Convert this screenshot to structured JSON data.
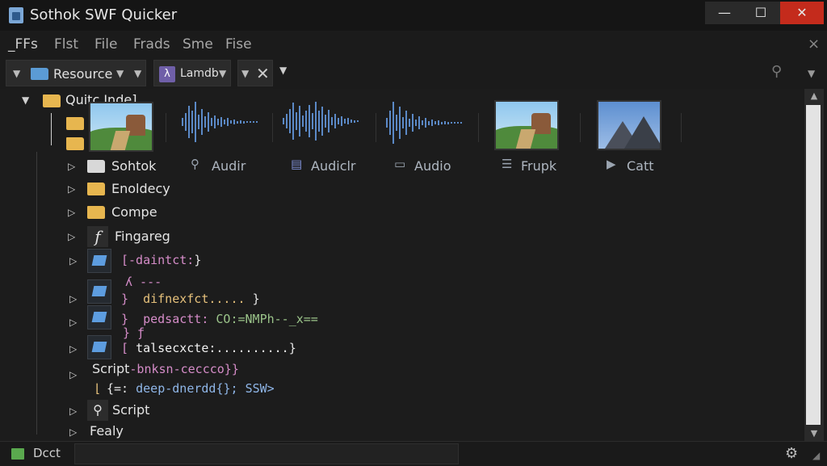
{
  "window": {
    "title": "Sothok SWF Quicker",
    "controls": {
      "minimize": "—",
      "maximize": "☐",
      "close": "✕"
    }
  },
  "menubar": {
    "items": [
      "_FFs",
      "Flst",
      "File",
      "Frads",
      "Sme",
      "Fise"
    ],
    "close_glyph": "×"
  },
  "toolbar": {
    "resource_label": "Resource",
    "lambda_label": "Lamdb",
    "lambda_glyph": "λ",
    "dropdown_glyph": "▼",
    "clear_glyph": "✕",
    "right_icon_glyph": "⚲"
  },
  "tree": {
    "root_label": "Quitc Inde]",
    "media_items": [
      {
        "type": "image",
        "label": ""
      },
      {
        "type": "audio",
        "label": "Audir",
        "glyph": "⚲"
      },
      {
        "type": "audio",
        "label": "Audiclr",
        "glyph": "▤"
      },
      {
        "type": "audio",
        "label": "Audio",
        "glyph": "▭"
      },
      {
        "type": "image",
        "label": "Frupk",
        "glyph": "☰"
      },
      {
        "type": "image",
        "label": "Catt",
        "glyph": "▶"
      }
    ],
    "folders": [
      "Sohtok",
      "Enoldecy",
      "Compe"
    ],
    "fingareg_label": "Fingareg",
    "code_lines": [
      {
        "bracket": "[",
        "text": "-daintct:",
        "close": "}"
      },
      {
        "bracket": "}",
        "text": "difnexfct.....",
        "close": "}"
      },
      {
        "bracket": "}",
        "text": "pedsactt:",
        "tail": "CO:=NMPh--_x=="
      },
      {
        "bracket": "[",
        "text": "talsecxcte:..........",
        "close": "}"
      }
    ],
    "script_line": {
      "label": "Script",
      "code": "-bnksn-ceccco}}"
    },
    "deep_line": {
      "prefix": "{=:",
      "code": "deep-dnerdd{};",
      "tail": "SSW>"
    },
    "script_item_label": "Script",
    "last_item_label": "Fealy"
  },
  "scrollbar": {
    "up": "▲",
    "down": "▼"
  },
  "statusbar": {
    "label": "Dcct",
    "gear_glyph": "⚙",
    "grip_glyph": "◢"
  },
  "colors": {
    "background": "#1c1c1c",
    "close_button": "#c42b1c",
    "folder_yellow": "#e7b64f",
    "audio_wave": "#5b89c6",
    "code_pink": "#d58cc8",
    "code_orange": "#e5c07b"
  }
}
